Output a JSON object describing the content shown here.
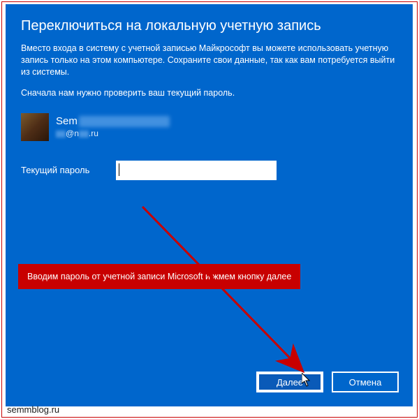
{
  "title": "Переключиться на локальную учетную запись",
  "description": "Вместо входа в систему с учетной записью Майкрософт вы можете использовать учетную запись только на этом компьютере. Сохраните свои данные, так как вам потребуется выйти из системы.",
  "description2": "Сначала нам нужно проверить ваш текущий пароль.",
  "user": {
    "name_prefix": "Sem",
    "email_prefix": "@",
    "email_mid": "n",
    "email_suffix": ".ru"
  },
  "field": {
    "label": "Текущий пароль",
    "value": ""
  },
  "callout": "Вводим пароль от учетной записи Microsoft и жмем кнопку далее",
  "buttons": {
    "next": "Далее",
    "cancel": "Отмена"
  },
  "watermark": "semmblog.ru",
  "colors": {
    "bg": "#0066cc",
    "accent": "#c80000"
  }
}
